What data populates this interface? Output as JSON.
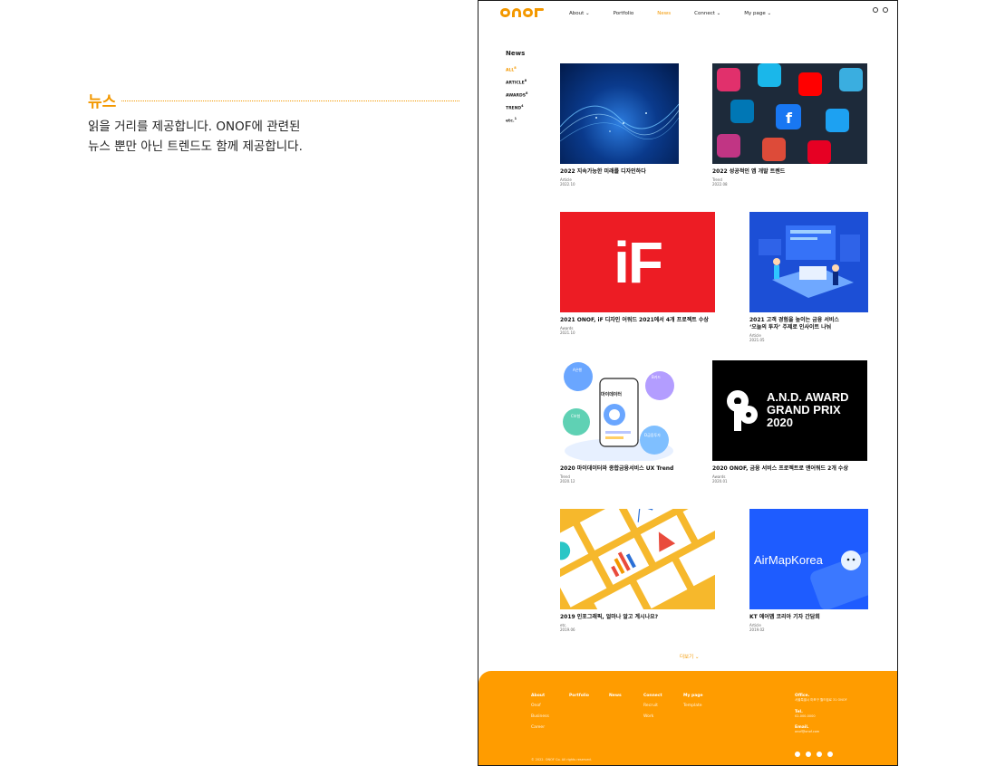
{
  "description": {
    "title": "뉴스",
    "text": "읽을 거리를 제공합니다. ONOF에 관련된\n뉴스 뿐만 아닌 트렌드도 함께 제공합니다."
  },
  "brand": {
    "accent": "#f39800",
    "footer_bg": "#ff9c00"
  },
  "header": {
    "nav": [
      {
        "label": "About ⌄"
      },
      {
        "label": "Portfolio"
      },
      {
        "label": "News"
      },
      {
        "label": "Connect ⌄"
      },
      {
        "label": "My page ⌄"
      }
    ],
    "icons": [
      "globe-icon",
      "close-icon"
    ]
  },
  "page": {
    "title": "News",
    "filters": [
      {
        "label": "ALL",
        "count": "8"
      },
      {
        "label": "ARTICLE",
        "count": "8"
      },
      {
        "label": "AWARDS",
        "count": "8"
      },
      {
        "label": "TREND",
        "count": "4"
      },
      {
        "label": "etc.",
        "count": "1"
      }
    ]
  },
  "cards": [
    {
      "title": "2022 지속가능한 미래를 디자인하다",
      "category": "Article",
      "date": "2022.10"
    },
    {
      "title": "2022 성공적인 앱 개발 트렌드",
      "category": "Trend",
      "date": "2022.08"
    },
    {
      "title": "2021 ONOF, iF 디자인 어워드 2021에서 4개 프로젝트 수상",
      "category": "Awards",
      "date": "2021.10"
    },
    {
      "title": "2021 고객 경험을 높이는 금융 서비스\n‘오늘의 투자’ 주제로 인사이트 나눠",
      "category": "Article",
      "date": "2021.05"
    },
    {
      "title": "2020 마이데이터와 종합금융서비스 UX Trend",
      "category": "Trend",
      "date": "2020.12"
    },
    {
      "title": "2020 ONOF, 금융 서비스 프로젝트로 앤어워드 2개 수상",
      "category": "Awards",
      "date": "2020.01"
    },
    {
      "title": "2019 인포그래픽, 얼마나 알고 계시나요?",
      "category": "etc.",
      "date": "2019.06"
    },
    {
      "title": "KT 에어맵 코리아 기자 간담회",
      "category": "Article",
      "date": "2019.02"
    }
  ],
  "thumb_text": {
    "if_logo": "iF",
    "and_award": "A.N.D. AWARD\nGRAND PRIX\n2020",
    "mydata_center": "마이데이터",
    "mydata_a": "A은행",
    "mydata_b": "B카드",
    "mydata_c": "C보험",
    "mydata_d": "D금융투자",
    "airmap": "AirMapKorea"
  },
  "more_label": "더보기 ⌄",
  "footer": {
    "columns": [
      {
        "heading": "About",
        "items": [
          "Onof",
          "Business",
          "Career"
        ]
      },
      {
        "heading": "Portfolio",
        "items": []
      },
      {
        "heading": "News",
        "items": []
      },
      {
        "heading": "Connect",
        "items": [
          "Recruit",
          "Work"
        ]
      },
      {
        "heading": "My page",
        "items": [
          "Template"
        ]
      }
    ],
    "office_heading": "Office.",
    "office_value": "서울특별시 마포구 월드컵로 31 ONOF",
    "tel_heading": "Tel.",
    "tel_value": "02-000-0000",
    "email_heading": "Email.",
    "email_value": "onof@onof.com",
    "copyright": "© 2022. ONOF Co. All rights reserved.",
    "social": [
      "twitter-icon",
      "instagram-icon",
      "facebook-icon",
      "youtube-icon"
    ]
  }
}
